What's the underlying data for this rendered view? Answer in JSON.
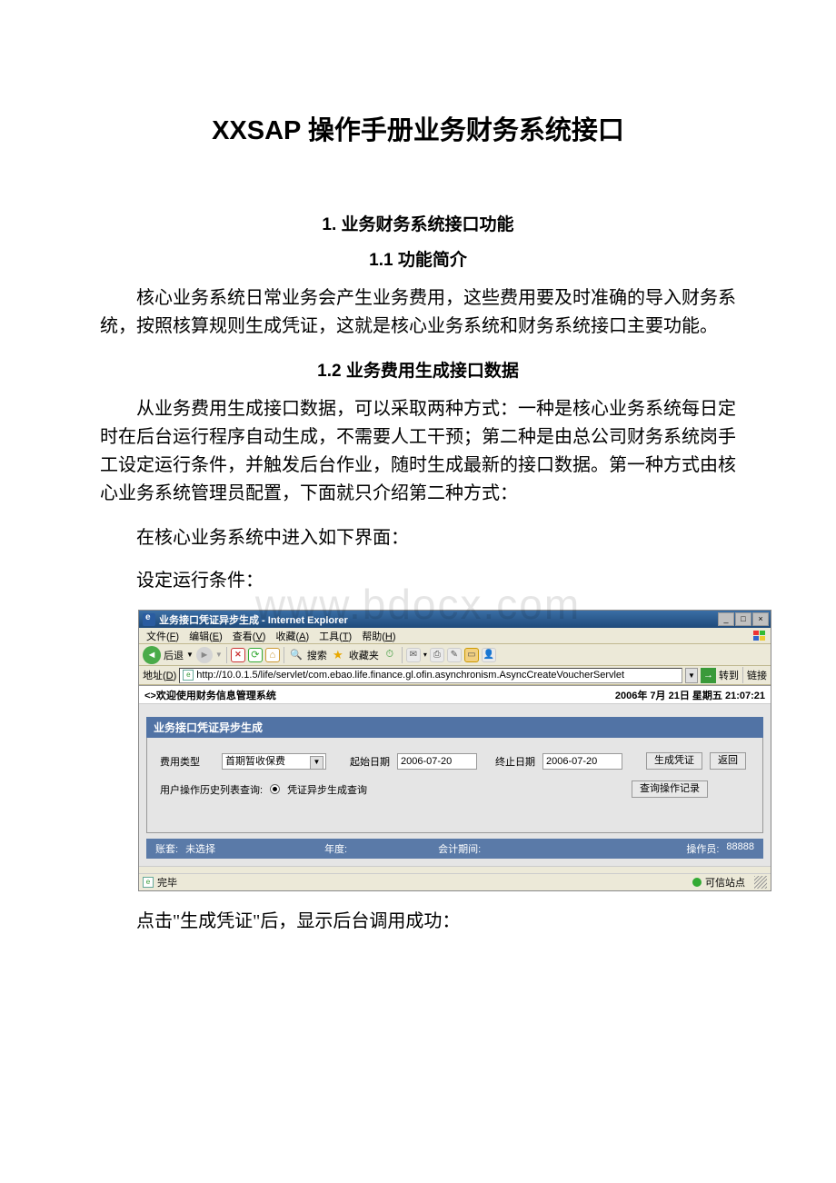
{
  "document": {
    "title": "XXSAP 操作手册业务财务系统接口",
    "section1": {
      "heading": "1. 业务财务系统接口功能",
      "sub1": {
        "heading": "1.1 功能简介",
        "p1": "核心业务系统日常业务会产生业务费用，这些费用要及时准确的导入财务系统，按照核算规则生成凭证，这就是核心业务系统和财务系统接口主要功能。"
      },
      "sub2": {
        "heading": "1.2 业务费用生成接口数据",
        "p1": "从业务费用生成接口数据，可以采取两种方式：一种是核心业务系统每日定时在后台运行程序自动生成，不需要人工干预；第二种是由总公司财务系统岗手工设定运行条件，并触发后台作业，随时生成最新的接口数据。第一种方式由核心业务系统管理员配置，下面就只介绍第二种方式：",
        "p2": "在核心业务系统中进入如下界面：",
        "p3": "设定运行条件：",
        "p4": "点击\"生成凭证\"后，显示后台调用成功："
      }
    }
  },
  "watermark": "www.bdocx.com",
  "screenshot": {
    "title": "业务接口凭证异步生成 - Internet Explorer",
    "menu": {
      "file": "文件(F)",
      "edit": "编辑(E)",
      "view": "查看(V)",
      "fav": "收藏(A)",
      "tools": "工具(T)",
      "help": "帮助(H)"
    },
    "toolbar": {
      "back": "后退",
      "search": "搜索",
      "favorites": "收藏夹"
    },
    "address": {
      "label": "地址(D)",
      "url": "http://10.0.1.5/life/servlet/com.ebao.life.finance.gl.ofin.asynchronism.AsyncCreateVoucherServlet",
      "go": "转到",
      "links": "链接"
    },
    "welcome": {
      "text": "<>欢迎使用财务信息管理系统",
      "datetime": "2006年 7月 21日 星期五 21:07:21"
    },
    "panel": {
      "title": "业务接口凭证异步生成",
      "feeType_label": "费用类型",
      "feeType_value": "首期暂收保费",
      "startDate_label": "起始日期",
      "startDate_value": "2006-07-20",
      "endDate_label": "终止日期",
      "endDate_value": "2006-07-20",
      "btn_generate": "生成凭证",
      "btn_back": "返回",
      "history_label": "用户操作历史列表查询:",
      "radio_label": "凭证异步生成查询",
      "btn_query": "查询操作记录"
    },
    "statusrow": {
      "book_label": "账套:",
      "book_value": "未选择",
      "year_label": "年度:",
      "period_label": "会计期间:",
      "operator_label": "操作员:",
      "operator_value": "88888"
    },
    "statusbar": {
      "done": "完毕",
      "trusted": "可信站点"
    }
  }
}
